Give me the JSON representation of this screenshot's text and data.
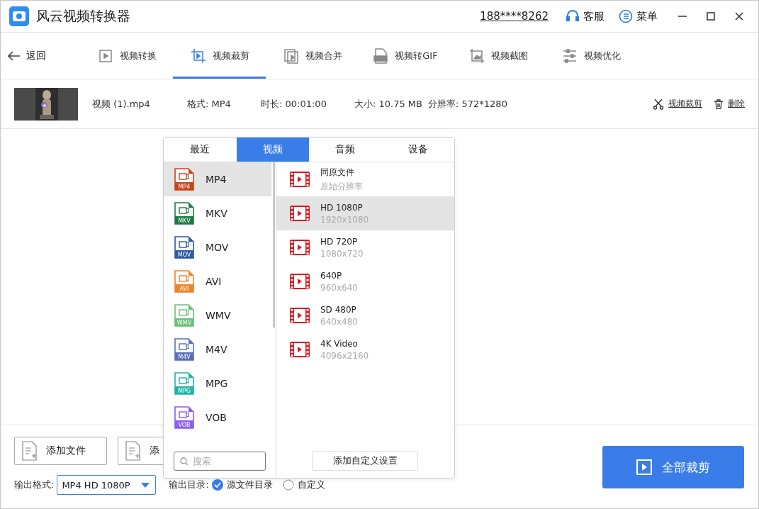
{
  "app": {
    "title": "风云视频转换器",
    "phone": "188****8262",
    "service": "客服",
    "menu": "菜单"
  },
  "nav": {
    "back": "返回",
    "tabs": [
      {
        "kind": "convert",
        "label": "视频转换",
        "selected": false
      },
      {
        "kind": "crop",
        "label": "视频裁剪",
        "selected": true
      },
      {
        "kind": "merge",
        "label": "视频合并",
        "selected": false
      },
      {
        "kind": "gif",
        "label": "视频转GIF",
        "selected": false
      },
      {
        "kind": "shot",
        "label": "视频截图",
        "selected": false
      },
      {
        "kind": "tune",
        "label": "视频优化",
        "selected": false
      }
    ]
  },
  "file": {
    "name": "视频 (1).mp4",
    "format": "格式: MP4",
    "duration": "时长: 00:01:00",
    "size": "大小: 10.75 MB",
    "resolution": "分辨率: 572*1280",
    "actions": [
      {
        "kind": "crop",
        "label": "视频裁剪"
      },
      {
        "kind": "delete",
        "label": "删除"
      }
    ]
  },
  "popup": {
    "tabs": [
      {
        "label": "最近",
        "selected": false
      },
      {
        "label": "视频",
        "selected": true
      },
      {
        "label": "音频",
        "selected": false
      },
      {
        "label": "设备",
        "selected": false
      }
    ],
    "formats": [
      {
        "label": "MP4",
        "badge": "MP4",
        "color": "#c9431b",
        "selected": true
      },
      {
        "label": "MKV",
        "badge": "MKV",
        "color": "#1e7a45",
        "selected": false
      },
      {
        "label": "MOV",
        "badge": "MOV",
        "color": "#2d5aa0",
        "selected": false
      },
      {
        "label": "AVI",
        "badge": "AVI",
        "color": "#f0852a",
        "selected": false
      },
      {
        "label": "WMV",
        "badge": "WMV",
        "color": "#6cc07a",
        "selected": false
      },
      {
        "label": "M4V",
        "badge": "M4V",
        "color": "#5a6fb8",
        "selected": false
      },
      {
        "label": "MPG",
        "badge": "MPG",
        "color": "#1fb5a8",
        "selected": false
      },
      {
        "label": "VOB",
        "badge": "VOB",
        "color": "#8b5cf6",
        "selected": false
      }
    ],
    "presets": [
      {
        "title": "同原文件",
        "detail": "原始分辨率",
        "selected": false
      },
      {
        "title": "HD 1080P",
        "detail": "1920x1080",
        "selected": true
      },
      {
        "title": "HD 720P",
        "detail": "1080x720",
        "selected": false
      },
      {
        "title": "640P",
        "detail": "960x640",
        "selected": false
      },
      {
        "title": "SD 480P",
        "detail": "640x480",
        "selected": false
      },
      {
        "title": "4K Video",
        "detail": "4096x2160",
        "selected": false
      }
    ],
    "search_placeholder": "搜索",
    "custom_button": "添加自定义设置"
  },
  "bottom": {
    "add_buttons": [
      "添加文件",
      "添"
    ],
    "output_format_label": "输出格式:",
    "output_format": "MP4 HD 1080P",
    "output_dir_label": "输出目录:",
    "dir_options": [
      {
        "label": "源文件目录",
        "selected": true
      },
      {
        "label": "自定义",
        "selected": false
      }
    ],
    "start_button": "全部裁剪"
  }
}
